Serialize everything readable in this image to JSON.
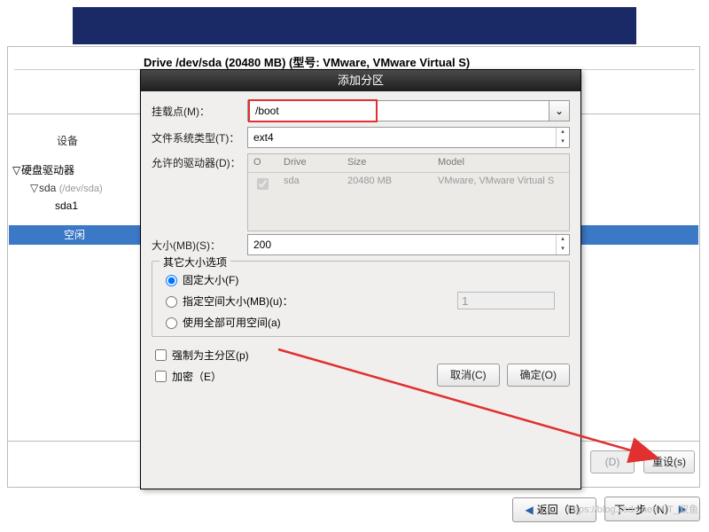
{
  "header": {
    "drive_line": "Drive /dev/sda (20480 MB) (型号: VMware, VMware Virtual S)"
  },
  "tree": {
    "device_header": "设备",
    "root": "硬盘驱动器",
    "sda_label": "sda",
    "sda_path": "(/dev/sda)",
    "sda1": "sda1",
    "free": "空闲"
  },
  "bg_buttons": {
    "d": "(D)",
    "reset": "重设(s)"
  },
  "nav": {
    "back": "返回（B）",
    "next": "下一步（N）"
  },
  "dialog": {
    "title": "添加分区",
    "mount_label": "挂载点(M)：",
    "mount_value": "/boot",
    "fs_label": "文件系统类型(T)：",
    "fs_value": "ext4",
    "drives_label": "允许的驱动器(D)：",
    "drives_headers": {
      "o": "O",
      "drive": "Drive",
      "size": "Size",
      "model": "Model"
    },
    "drives_row": {
      "name": "sda",
      "size": "20480 MB",
      "model": "VMware, VMware Virtual S"
    },
    "size_label": "大小(MB)(S)：",
    "size_value": "200",
    "size_group": "其它大小选项",
    "radio_fixed": "固定大小(F)",
    "radio_fill_up": "指定空间大小(MB)(u)：",
    "radio_fill_all": "使用全部可用空间(a)",
    "fill_up_value": "1",
    "chk_primary": "强制为主分区(p)",
    "chk_encrypt": "加密（E）",
    "btn_cancel": "取消(C)",
    "btn_ok": "确定(O)"
  },
  "watermark": "https://blog.csdn.net/HIT_双鱼"
}
